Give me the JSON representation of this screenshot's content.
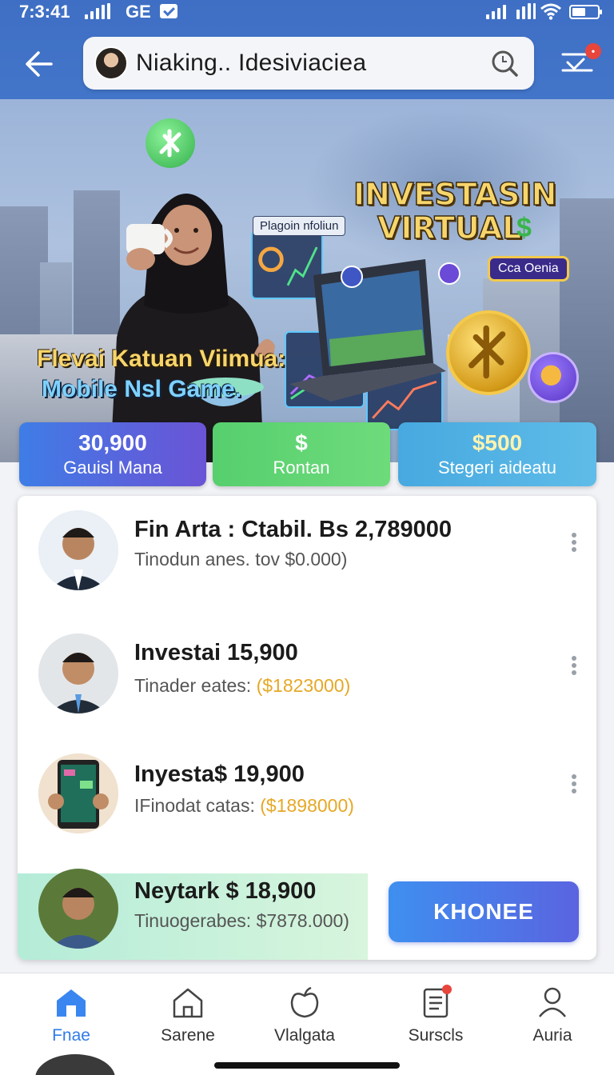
{
  "status_bar": {
    "time": "7:3:41",
    "carrier": "GE"
  },
  "header": {
    "search_query": "Niaking.. Idesiviaciea"
  },
  "banner": {
    "headline_line1": "INVESTASIN",
    "headline_line2": "VIRTUAL",
    "tagline_line1": "Flevai Katuan Viimua:",
    "tagline_line2": "Mobile Nsl Game.",
    "chip_left": "Plagoin nfoliun",
    "chip_right": "Cca Oenia"
  },
  "stats": [
    {
      "value": "30,900",
      "label": "Gauisl Mana"
    },
    {
      "value": "$",
      "label": "Rontan"
    },
    {
      "value": "$500",
      "label": "Stegeri aideatu"
    }
  ],
  "list": [
    {
      "title": "Fin Arta : Ctabil. Bs  2,789000",
      "sub": "Tinodun anes. tov  $0.000)",
      "sub_highlight": ""
    },
    {
      "title": "Investai  15,900",
      "sub": "Tinader eates:  ",
      "sub_highlight": "($1823000)"
    },
    {
      "title": "Inyesta$ 19,900",
      "sub": "IFinodat catas:  ",
      "sub_highlight": "($1898000)"
    },
    {
      "title": "Neytark $ 18,900",
      "sub": "Tinuogerabes:  $7878.000)",
      "sub_highlight": ""
    }
  ],
  "cta": {
    "label": "KHONEE"
  },
  "bottom_nav": [
    {
      "label": "Fnae",
      "icon": "home-filled-icon"
    },
    {
      "label": "Sarene",
      "icon": "home-outline-icon"
    },
    {
      "label": "Vlalgata",
      "icon": "apple-icon"
    },
    {
      "label": "Surscls",
      "icon": "document-icon"
    },
    {
      "label": "Auria",
      "icon": "profile-icon"
    }
  ],
  "colors": {
    "app_bar": "#4275c9",
    "accent": "#2f7be8",
    "cta": "#3e8ff0",
    "highlight": "#e6a826"
  }
}
